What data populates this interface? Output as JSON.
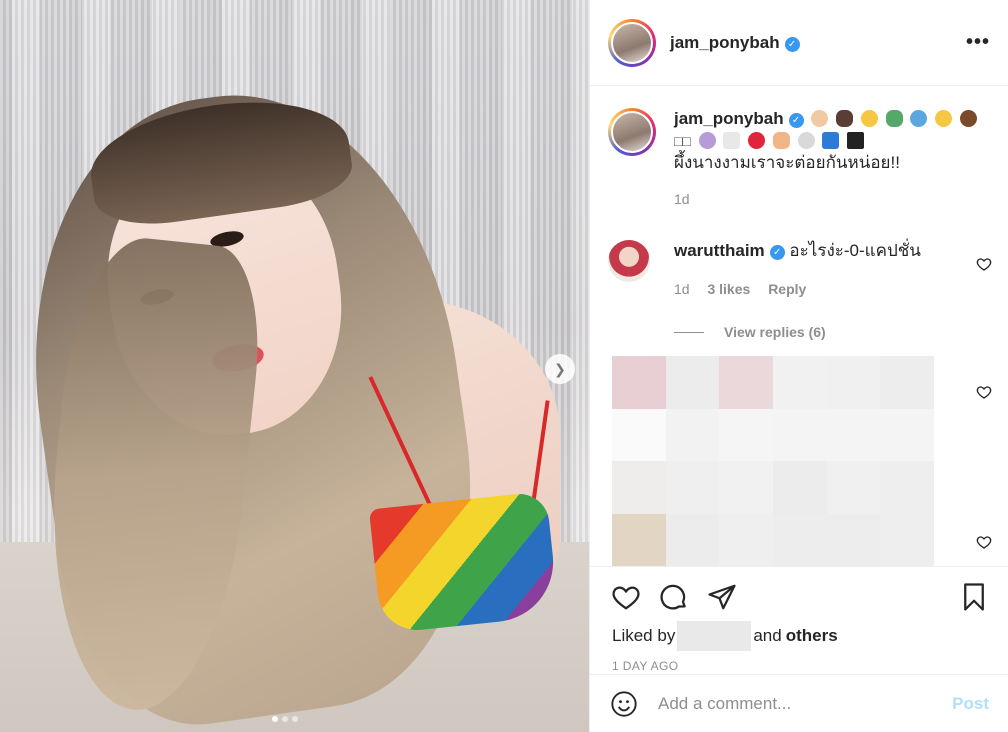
{
  "post": {
    "username": "jam_ponybah",
    "verified_mark": "✓",
    "more_label": "•••",
    "caption_line2_boxes": "□□",
    "caption_text": "ผึ้งนางงามเราจะต่อยกันหน่อย!!",
    "caption_time": "1d",
    "emojis": [
      "man-face-icon",
      "boar-icon",
      "dizzy-face-icon",
      "ufo-icon",
      "anxious-face-icon",
      "shocked-face-icon",
      "poop-icon",
      "woman-facepalm-icon",
      "ambulance-icon",
      "red-heart-icon",
      "bandage-icon",
      "skull-crossbones-icon",
      "soon-arrow-icon",
      "pirate-flag-icon"
    ],
    "carousel": {
      "slides": 3,
      "current": 1,
      "next_icon": "chevron-right-icon"
    }
  },
  "comment": {
    "username": "warutthaim",
    "text": "อะไรง่ะ-0-แคปชั่น",
    "time": "1d",
    "likes": "3 likes",
    "reply": "Reply",
    "view_replies": "View replies (6)"
  },
  "actions": {
    "liked_by": "Liked by",
    "and": "and",
    "others": "others",
    "date": "1 DAY AGO"
  },
  "add_comment": {
    "placeholder": "Add a comment...",
    "post_label": "Post"
  },
  "colors": {
    "verified": "#3897f0",
    "post_button": "#b2dffc",
    "meta": "#8e8e8e"
  }
}
